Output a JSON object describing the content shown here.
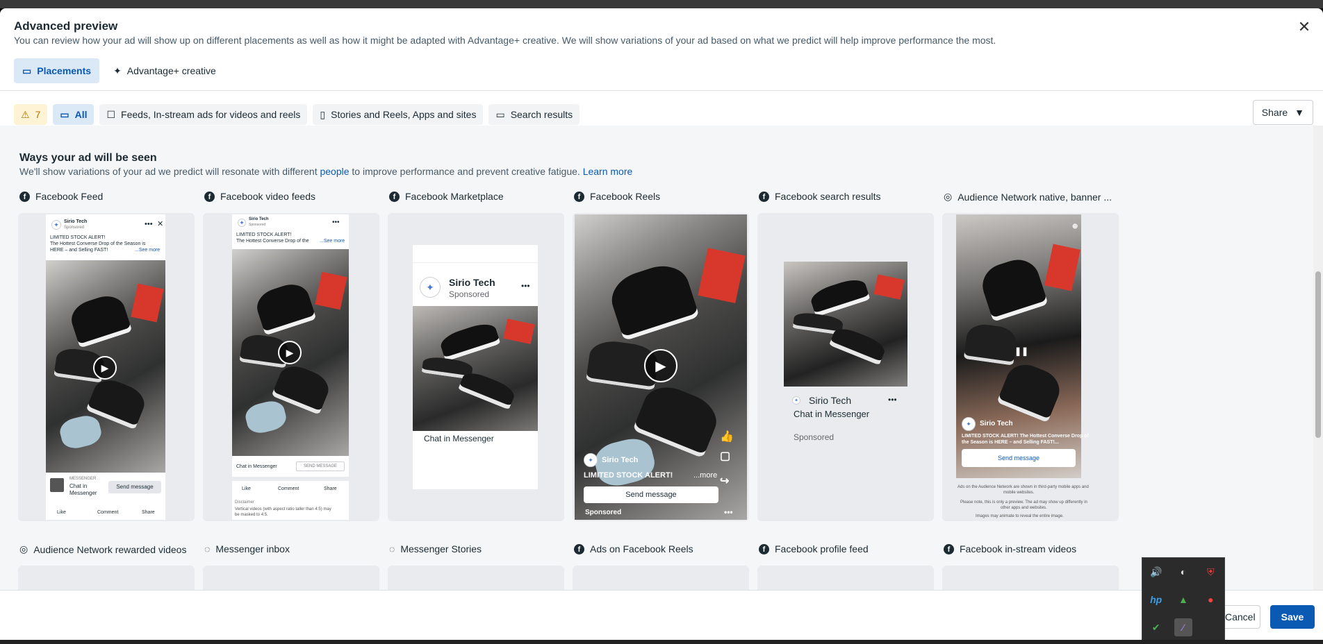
{
  "header": {
    "title": "Advanced preview",
    "subtitle": "You can review how your ad will show up on different placements as well as how it might be adapted with Advantage+ creative. We will show variations of your ad based on what we predict will help improve performance the most."
  },
  "tabs": [
    {
      "label": "Placements",
      "active": true
    },
    {
      "label": "Advantage+ creative",
      "active": false
    }
  ],
  "filters": {
    "warning_count": "7",
    "all_label": "All",
    "feeds_label": "Feeds, In-stream ads for videos and reels",
    "stories_label": "Stories and Reels, Apps and sites",
    "search_label": "Search results",
    "share_label": "Share"
  },
  "section": {
    "title": "Ways your ad will be seen",
    "sub_pre": "We'll show variations of your ad we predict will resonate with different ",
    "sub_people": "people",
    "sub_mid": " to improve performance and prevent creative fatigue. ",
    "learn_more": "Learn more"
  },
  "placements": [
    {
      "label": "Facebook Feed",
      "icon": "facebook-icon"
    },
    {
      "label": "Facebook video feeds",
      "icon": "facebook-icon"
    },
    {
      "label": "Facebook Marketplace",
      "icon": "facebook-icon"
    },
    {
      "label": "Facebook Reels",
      "icon": "facebook-icon"
    },
    {
      "label": "Facebook search results",
      "icon": "facebook-icon"
    },
    {
      "label": "Audience Network native, banner ...",
      "icon": "audience-network-icon"
    }
  ],
  "placements_row2": [
    {
      "label": "Audience Network rewarded videos",
      "icon": "audience-network-icon"
    },
    {
      "label": "Messenger inbox",
      "icon": "messenger-icon"
    },
    {
      "label": "Messenger Stories",
      "icon": "messenger-icon"
    },
    {
      "label": "Ads on Facebook Reels",
      "icon": "facebook-icon"
    },
    {
      "label": "Facebook profile feed",
      "icon": "facebook-icon"
    },
    {
      "label": "Facebook in-stream videos",
      "icon": "facebook-icon"
    }
  ],
  "ad": {
    "page_name": "Sirio Tech",
    "sponsored": "Sponsored",
    "headline_1": "LIMITED STOCK ALERT!",
    "headline_2": "The Hottest Converse Drop of the Season is",
    "headline_3": "HERE – and Selling FAST!",
    "headline_video": "The Hottest Converse Drop of the",
    "see_more": "...See more",
    "messenger_caps": "MESSENGER",
    "chat_in_messenger": "Chat in Messenger",
    "chat_line1": "Chat in",
    "chat_line2": "Messenger",
    "send_message": "Send message",
    "send_message_caps": "SEND MESSAGE",
    "like": "Like",
    "comment": "Comment",
    "share": "Share",
    "disclaimer": "Disclaimer",
    "disclaimer_text_1": "Vertical videos (with aspect ratio taller than 4:5) may",
    "disclaimer_text_2": "be masked to 4:5.",
    "reels_headline": "LIMITED STOCK ALERT!",
    "reels_more": "...more",
    "an_headline_1": "LIMITED STOCK ALERT! The Hottest Converse Drop of",
    "an_headline_2": "the Season is HERE – and Selling FAST!...",
    "an_send": "Send message",
    "an_note_1": "Ads on the Audience Network are shown in third-party mobile apps and",
    "an_note_2": "mobile websites.",
    "an_note_3": "Please note, this is only a preview. The ad may show up differently in",
    "an_note_4": "other apps and websites.",
    "an_note_5": "Images may animate to reveal the entire image."
  },
  "footer": {
    "cancel": "Cancel",
    "save": "Save"
  },
  "colors": {
    "accent": "#0a5ab4",
    "warning": "#b27200",
    "active_tab_bg": "#dbe9f7"
  }
}
